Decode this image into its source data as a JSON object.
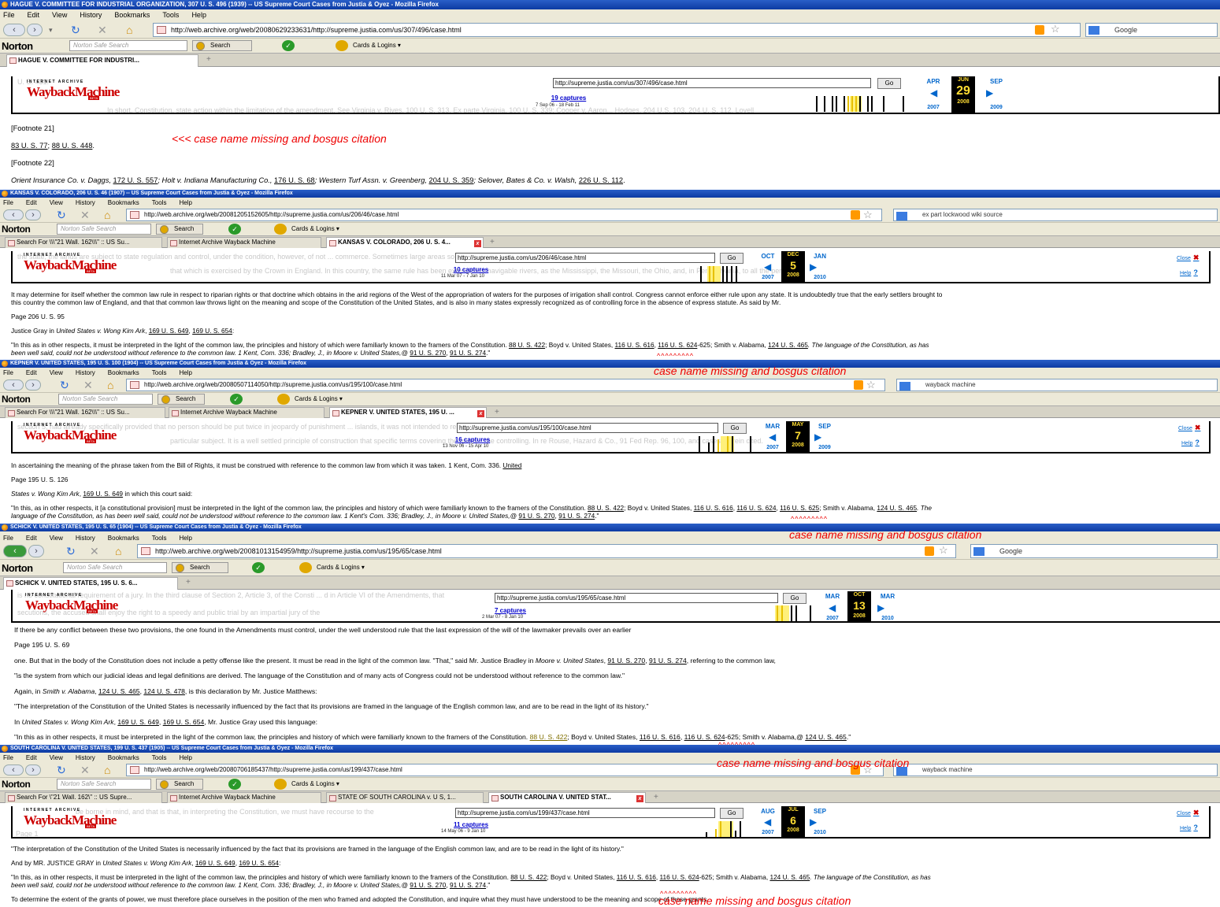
{
  "windows": [
    {
      "title": "HAGUE V. COMMITTEE FOR INDUSTRIAL ORGANIZATION, 307 U. S. 496 (1939) -- US Supreme Court Cases from Justia & Oyez - Mozilla Firefox",
      "url": "http://web.archive.org/web/20080629233631/http://supreme.justia.com/us/307/496/case.html",
      "search": "Google",
      "tabs": [
        "HAGUE V. COMMITTEE FOR INDUSTRI..."
      ],
      "wb_url": "http://supreme.justia.com/us/307/496/case.html",
      "captures": "19 captures",
      "cap_dates": "7 Sep 06 - 18 Feb 11",
      "prev": {
        "m": "APR",
        "y": "2007"
      },
      "cur": {
        "m": "JUN",
        "d": "29",
        "y": "2008"
      },
      "next": {
        "m": "SEP",
        "y": "2009"
      },
      "ghost": "  U. S. 431.",
      "ghost2": "In short, Constitution, state action within the limitation of the amendment. See Virginia v. Rives, 100 U. S. 313. Ex parte Virginia, 100 U. S. 339; Cooper v. Aaron... Hodges, 204 U.S. 103, 204 U. S. 112. Lovell"
    },
    {
      "title": "KANSAS V. COLORADO, 206 U. S. 46 (1907) -- US Supreme Court Cases from Justia & Oyez - Mozilla Firefox",
      "url": "http://web.archive.org/web/20081205152605/http://supreme.justia.com/us/206/46/case.html",
      "search": "ex part lockwood wiki source",
      "tabs": [
        "Search For \\\\\\\"21 Wall. 162\\\\\\\" :: US Su...",
        "Internet Archive Wayback Machine",
        "KANSAS V. COLORADO, 206 U. S. 4..."
      ],
      "wb_url": "http://supreme.justia.com/us/206/46/case.html",
      "captures": "10 captures",
      "cap_dates": "11 Mar 07 - 7 Jan 10",
      "prev": {
        "m": "OCT",
        "y": "2007"
      },
      "cur": {
        "m": "DEC",
        "d": "5",
        "y": "2008"
      },
      "next": {
        "m": "JAN",
        "y": "2010"
      },
      "ghost": "the state, the lands are subject to state regulation and control, under the condition, however, of not ... commerce.     Sometimes large areas so reclaimed are occupied by cities, and are put to",
      "ghost2": "that which is exercised by the Crown in England. In this country, the same rule has been extended to navigable rivers, as the Mississippi, the Missouri, the Ohio, and, in Pennsylvania, to all the per"
    },
    {
      "title": "KEPNER V. UNITED STATES, 195 U. S. 100 (1904) -- US Supreme Court Cases from Justia & Oyez - Mozilla Firefox",
      "url": "http://web.archive.org/web/20080507114050/http://supreme.justia.com/us/195/100/case.html",
      "search": "wayback machine",
      "tabs": [
        "Search For \\\\\\\"21 Wall. 162\\\\\\\" :: US Su...",
        "Internet Archive Wayback Machine",
        "KEPNER V. UNITED STATES, 195 U. ..."
      ],
      "wb_url": "http://supreme.justia.com/us/195/100/case.html",
      "captures": "16 captures",
      "cap_dates": "13 Nov 06 - 15 Apr 10",
      "prev": {
        "m": "MAR",
        "y": "2007"
      },
      "cur": {
        "m": "MAY",
        "d": "7",
        "y": "2008"
      },
      "next": {
        "m": "SEP",
        "y": "2009"
      },
      "ghost": "section 5, had already specifically provided that no person should be put twice in jeopardy of punishment ... islands, it was not intended to repeal the specific guaranty of section 5, which is direct legislation",
      "ghost2": "particular subject. It is a well settled principle of construction that specific terms covering the given ... be controlling. In re Rouse, Hazard & Co., 91 Fed Rep. 96, 100, and cases therein cited."
    },
    {
      "title": "SCHICK V. UNITED STATES, 195 U. S. 65 (1904) -- US Supreme Court Cases from Justia & Oyez - Mozilla Firefox",
      "url": "http://web.archive.org/web/20081013154959/http://supreme.justia.com/us/195/65/case.html",
      "search": "Google",
      "tabs": [
        "SCHICK V. UNITED STATES, 195 U. S. 6..."
      ],
      "wb_url": "http://supreme.justia.com/us/195/65/case.html",
      "captures": "7 captures",
      "cap_dates": "2 Mar 07 - 8 Jan 10",
      "prev": {
        "m": "MAR",
        "y": "2007"
      },
      "cur": {
        "m": "OCT",
        "d": "13",
        "y": "2008"
      },
      "next": {
        "m": "MAR",
        "y": "2010"
      },
      "ghost": "   is no constitutional requirement of a jury. In the third clause of Section 2, Article 3, of the Consti ... d in Article VI of the Amendments, that",
      "ghost2": "   secutions, the accused shall enjoy the right to a speedy and public trial by an impartial jury of the"
    },
    {
      "title": "SOUTH CAROLINA V. UNITED STATES, 199 U. S. 437 (1905) -- US Supreme Court Cases from Justia & Oyez - Mozilla Firefox",
      "url": "http://web.archive.org/web/20080706185437/http://supreme.justia.com/us/199/437/case.html",
      "search": "wayback machine",
      "tabs": [
        "Search For \\\"21 Wall. 162\\\" :: US Supre...",
        "Internet Archive Wayback Machine",
        "STATE OF SOUTH CAROLINA v. U S, 1...",
        "SOUTH CAROLINA V. UNITED STAT..."
      ],
      "wb_url": "http://supreme.justia.com/us/199/437/case.html",
      "captures": "11 captures",
      "cap_dates": "14 May 06 - 9 Jan 10",
      "prev": {
        "m": "AUG",
        "y": "2007"
      },
      "cur": {
        "m": "JUL",
        "d": "6",
        "y": "2008"
      },
      "next": {
        "m": "SEP",
        "y": "2010"
      },
      "ghost": "   be borne in mind, and that is that, in interpreting the Constitution, we must have recourse to the",
      "ghost2": "Page 1"
    }
  ],
  "menu": [
    "File",
    "Edit",
    "View",
    "History",
    "Bookmarks",
    "Tools",
    "Help"
  ],
  "norton": {
    "logo": "Norton",
    "search_placeholder": "Norton Safe Search",
    "search_btn": "Search",
    "cards": "Cards & Logins"
  },
  "wb_go": "Go",
  "wb_close": "Close",
  "wb_help": "Help",
  "annotation": "case name missing and bosgus citation",
  "annotation_first": "<<< case name missing and bosgus citation",
  "carets": "^^^^^^^^^",
  "w1": {
    "fn21": "[Footnote 21]",
    "fn21_body_a": "83 U. S. 77",
    "fn21_body_b": "; ",
    "fn21_body_c": "88 U. S. 448",
    "fn21_body_d": ".",
    "fn22": "[Footnote 22]",
    "fn22_body": [
      "Orient Insurance Co. v. Daggs, ",
      "172 U. S. 557",
      "; Holt v. Indiana Manufacturing Co., ",
      "176 U. S. 68",
      "; Western Turf Assn. v. Greenberg, ",
      "204 U. S. 359",
      "; Selover, Bates & Co. v. Walsh, ",
      "226 U. S. 112",
      "."
    ]
  },
  "w2": {
    "l1": "It may determine for itself whether the common law rule in respect to riparian rights or that doctrine which obtains in the arid regions of the West of the appropriation of waters for the purposes of irrigation shall control. Congress cannot enforce either rule upon any state. It is undoubtedly true that the early settlers brought to",
    "l2": "this country the common law of England, and that that common law throws light on the meaning and scope of the Constitution of the United States, and is also in many states expressly recognized as of controlling force in the absence of express statute. As said by Mr.",
    "page": "Page 206 U. S. 95",
    "l3a": "Justice Gray in ",
    "l3b": "United States v. Wong Kim Ark",
    "l3c": ", ",
    "l3d": "169 U. S. 649",
    "l3e": ", ",
    "l3f": "169 U. S. 654",
    "l3g": ":",
    "q1a": "\"In this as in other respects, it must be interpreted in the light of the common law, the principles and history of which were familiarly known to the framers of the Constitution. ",
    "q1b": "88 U. S. 422",
    "q1c": "; Boyd v. United States, ",
    "q1d": "116 U. S. 616",
    "q1e": ", ",
    "q1f": "116 U. S. 624",
    "q1g": "-625; Smith v. Alabama, ",
    "q1h": "124 U. S. 465",
    "q1i": ". The language of the Constitution, as has",
    "q2a": "been well said, could not be understood without reference to the common law. 1 Kent, Com. 336; Bradley, J., in Moore v. United States,@ ",
    "q2b": "91 U. S. 270",
    "q2c": ", ",
    "q2d": "91 U. S. 274",
    "q2e": ".\""
  },
  "w3": {
    "l1a": "In ascertaining the meaning of the phrase taken from the Bill of Rights, it must be construed with reference to the common law from which it was taken. 1 Kent, Com. 336. ",
    "l1b": "United",
    "page": "Page 195 U. S. 126",
    "l2a": "States v. Wong Kim Ark",
    ", ": "",
    "l2b": ", ",
    "l2c": "169 U. S. 649",
    "l2d": " in which this court said:",
    "q1a": "\"In this, as in other respects, it [a constitutional provision] must be interpreted in the light of the common law, the principles and history of which were familiarly known to the framers of the Constitution. ",
    "q1b": "88 U. S. 422",
    "q1c": "; Boyd v. United States, ",
    "q1d": "116 U. S. 616",
    "q1e": ", ",
    "q1f": "116 U. S. 624",
    "q1g": ", ",
    "q1h": "116 U. S. 625",
    "q1i": "; Smith v. Alabama, ",
    "q1j": "124 U. S. 465",
    "q1k": ". The",
    "q2a": "language of the Constitution, as has been well said, could not be understood without reference to the common law. 1 Kent's Com. 336; Bradley, J., in Moore v. United States,@ ",
    "q2b": "91 U. S. 270",
    "q2c": ", ",
    "q2d": "91 U. S. 274",
    "q2e": ".\""
  },
  "w4": {
    "l0": "If there be any conflict between these two provisions, the one found in the Amendments must control, under the well understood rule that the last expression of the will of the lawmaker prevails over an earlier",
    "page": "Page 195 U. S. 69",
    "l1a": "one. But that in the body of the Constitution does not include a petty offense like the present. It must be read in the light of the common law. \"That,\" said Mr. Justice Bradley in ",
    "l1b": "Moore v. United States",
    "l1c": ", ",
    "l1d": "91 U. S. 270",
    "l1e": ", ",
    "l1f": "91 U. S. 274",
    "l1g": ", referring to the common law,",
    "l2": "\"is the system from which our judicial ideas and legal definitions are derived. The language of the Constitution and of many acts of Congress could not be understood without reference to the common law.\"",
    "l3a": "Again, in ",
    "l3b": "Smith v. Alabama",
    "l3c": ", ",
    "l3d": "124 U. S. 465",
    "l3e": ", ",
    "l3f": "124 U. S. 478",
    "l3g": ", is this declaration by Mr. Justice Matthews:",
    "l4": "\"The interpretation of the Constitution of the United States is necessarily influenced by the fact that its provisions are framed in the language of the English common law, and are to be read in the light of its history.\"",
    "l5a": "In ",
    "l5b": "United States v. Wong Kim Ark",
    "l5c": ", ",
    "l5d": "169 U. S. 649",
    "l5e": ", ",
    "l5f": "169 U. S. 654",
    "l5g": ", Mr. Justice Gray used this language:",
    "l6a": "\"In this as in other respects, it must be interpreted in the light of the common law, the principles and history of which were familiarly known to the framers of the Constitution. ",
    "l6b": "88 U. S. 422",
    "l6c": "; Boyd v. United States, ",
    "l6d": "116 U. S. 616",
    "l6e": ", ",
    "l6f": "116 U. S. 624",
    "l6g": "-625; Smith v. Alabama,@ ",
    "l6h": "124 U. S. 465",
    "l6i": ".\""
  },
  "w5": {
    "l1": "\"The interpretation of the Constitution of the United States is necessarily influenced by the fact that its provisions are framed in the language of the English common law, and are to be read in the light of its history.\"",
    "l2a": "And by MR. JUSTICE GRAY in ",
    "l2b": "United States v. Wong Kim Ark",
    "l2c": ", ",
    "l2d": "169 U. S. 649",
    "l2e": ", ",
    "l2f": "169 U. S. 654",
    "l2g": ":",
    "q1a": "\"In this, as in other respects, it must be interpreted in the light of the common law, the principles and history of which were familiarly known to the framers of the Constitution. ",
    "q1b": "88 U. S. 422",
    "q1c": "; Boyd v. United States, ",
    "q1d": "116 U. S. 616",
    "q1e": ", ",
    "q1f": "116 U. S. 624",
    "q1g": "-625; Smith v. Alabama, ",
    "q1h": "124 U. S. 465",
    "q1i": ". The language of the Constitution, as has",
    "q2a": "been well said, could not be understood without reference to the common law. 1 Kent, Com. 336; Bradley, J., in Moore v. United States,@ ",
    "q2b": "91 U. S. 270",
    "q2c": ", ",
    "q2d": "91 U. S. 274",
    "q2e": ".\"",
    "l3": "To determine the extent of the grants of power, we must therefore place ourselves in the position of the men who framed and adopted the Constitution, and inquire what they must have understood to be the meaning and scope of those grants."
  }
}
